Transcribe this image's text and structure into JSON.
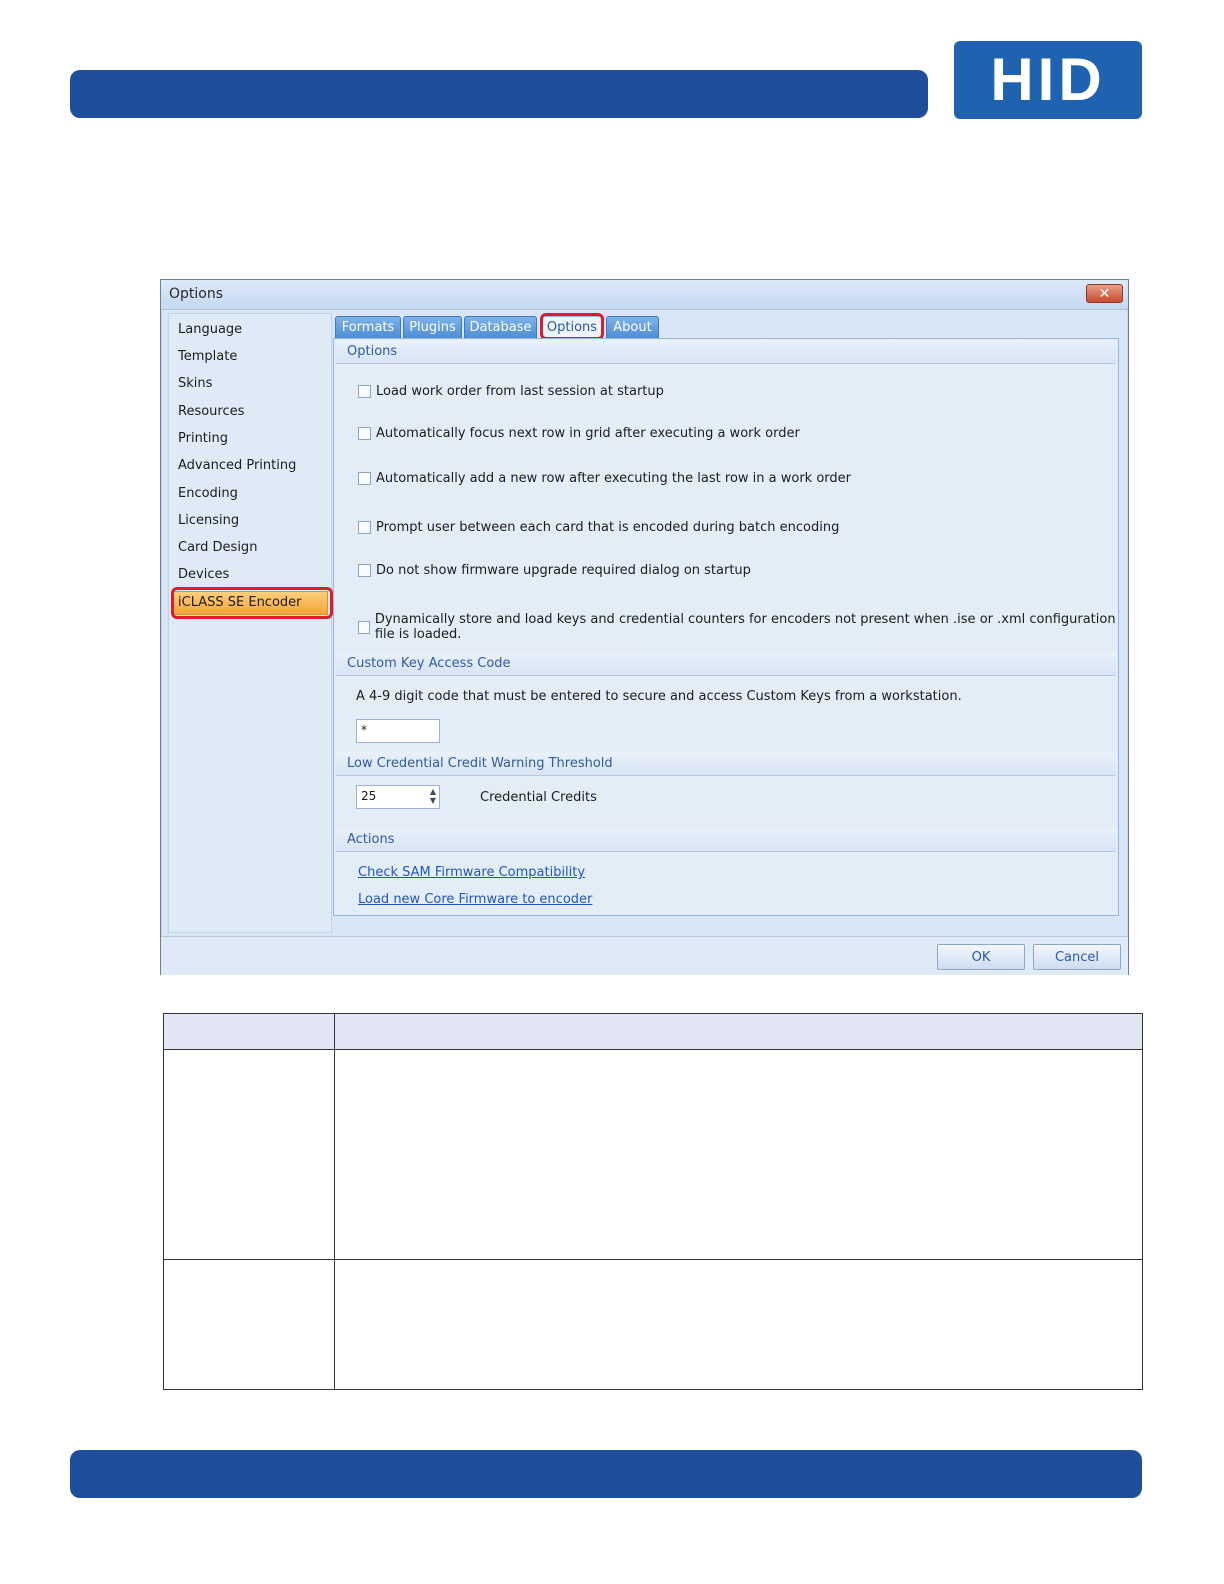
{
  "brand": {
    "logo_text": "HID",
    "header_color": "#1f4e9a",
    "logo_color": "#1f63b0"
  },
  "dialog": {
    "title": "Options",
    "close_icon": "close-icon",
    "nav": [
      {
        "label": "Language"
      },
      {
        "label": "Template"
      },
      {
        "label": "Skins"
      },
      {
        "label": "Resources"
      },
      {
        "label": "Printing"
      },
      {
        "label": "Advanced Printing"
      },
      {
        "label": "Encoding"
      },
      {
        "label": "Licensing"
      },
      {
        "label": "Card Design"
      },
      {
        "label": "Devices"
      },
      {
        "label": "iCLASS SE Encoder",
        "selected": true
      }
    ],
    "tabs": [
      {
        "label": "Formats"
      },
      {
        "label": "Plugins"
      },
      {
        "label": "Database"
      },
      {
        "label": "Options",
        "active": true
      },
      {
        "label": "About"
      }
    ],
    "options_group": {
      "header": "Options",
      "checkboxes": [
        {
          "label": "Load work order from last session at startup",
          "checked": false
        },
        {
          "label": "Automatically focus next row in grid after executing a work order",
          "checked": false
        },
        {
          "label": "Automatically add a new row after executing the last row in a work order",
          "checked": false
        },
        {
          "label": "Prompt user between each card that is encoded during batch encoding",
          "checked": false
        },
        {
          "label": "Do not show firmware upgrade required dialog on startup",
          "checked": false
        },
        {
          "label": "Dynamically store and load keys and credential counters for encoders not present when .ise or .xml configuration file is loaded.",
          "checked": false
        }
      ]
    },
    "custom_key": {
      "header": "Custom Key Access Code",
      "description": "A 4-9 digit code that must be entered to secure and access Custom Keys from a workstation.",
      "value": "*"
    },
    "low_credit": {
      "header": "Low Credential Credit Warning Threshold",
      "value": "25",
      "unit_label": "Credential Credits"
    },
    "actions": {
      "header": "Actions",
      "links": [
        {
          "label": "Check SAM Firmware Compatibility"
        },
        {
          "label": "Load new Core Firmware to encoder"
        }
      ]
    },
    "buttons": {
      "ok": "OK",
      "cancel": "Cancel"
    }
  }
}
